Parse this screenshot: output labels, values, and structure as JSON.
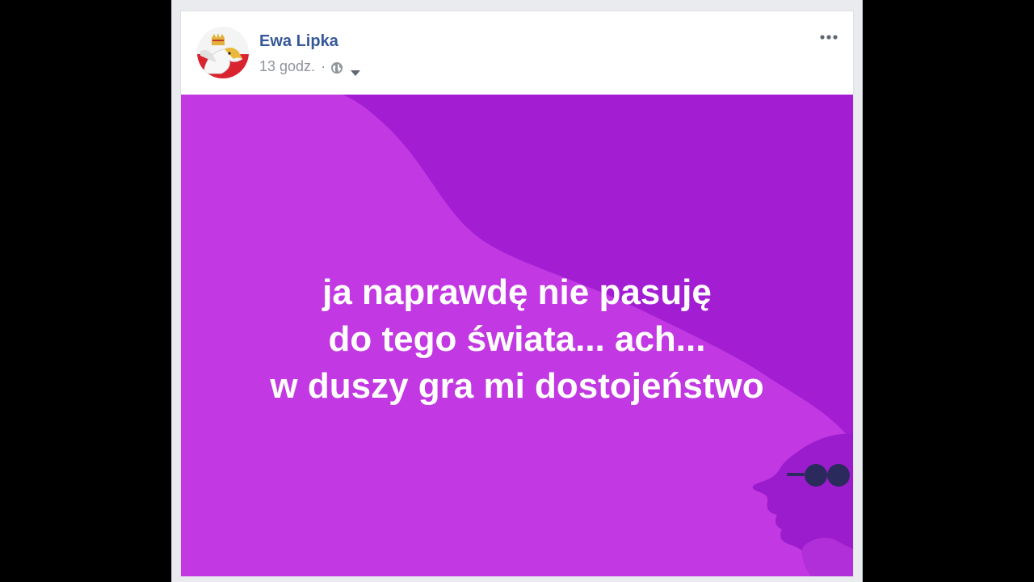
{
  "post": {
    "author": "Ewa Lipka",
    "time": "13 godz.",
    "separator": "·",
    "privacy_icon": "globe-icon",
    "audience_icon": "caret-down-icon",
    "more_icon": "more-horizontal-icon",
    "text_lines": [
      "ja naprawdę nie pasuję",
      "do tego świata... ach...",
      "w duszy gra mi dostojeństwo"
    ],
    "background": {
      "base_color": "#c238e2",
      "shade_color": "#a31ed3",
      "figure_color": "#9a1ccc",
      "glasses_color": "#2b2a5c",
      "illustration_icon": "woman-with-sunglasses-illustration"
    }
  },
  "colors": {
    "author_link": "#365899",
    "meta_text": "#90949c",
    "card_bg": "#ffffff",
    "page_bg": "#e9ebee",
    "outer_bg": "#000000"
  }
}
